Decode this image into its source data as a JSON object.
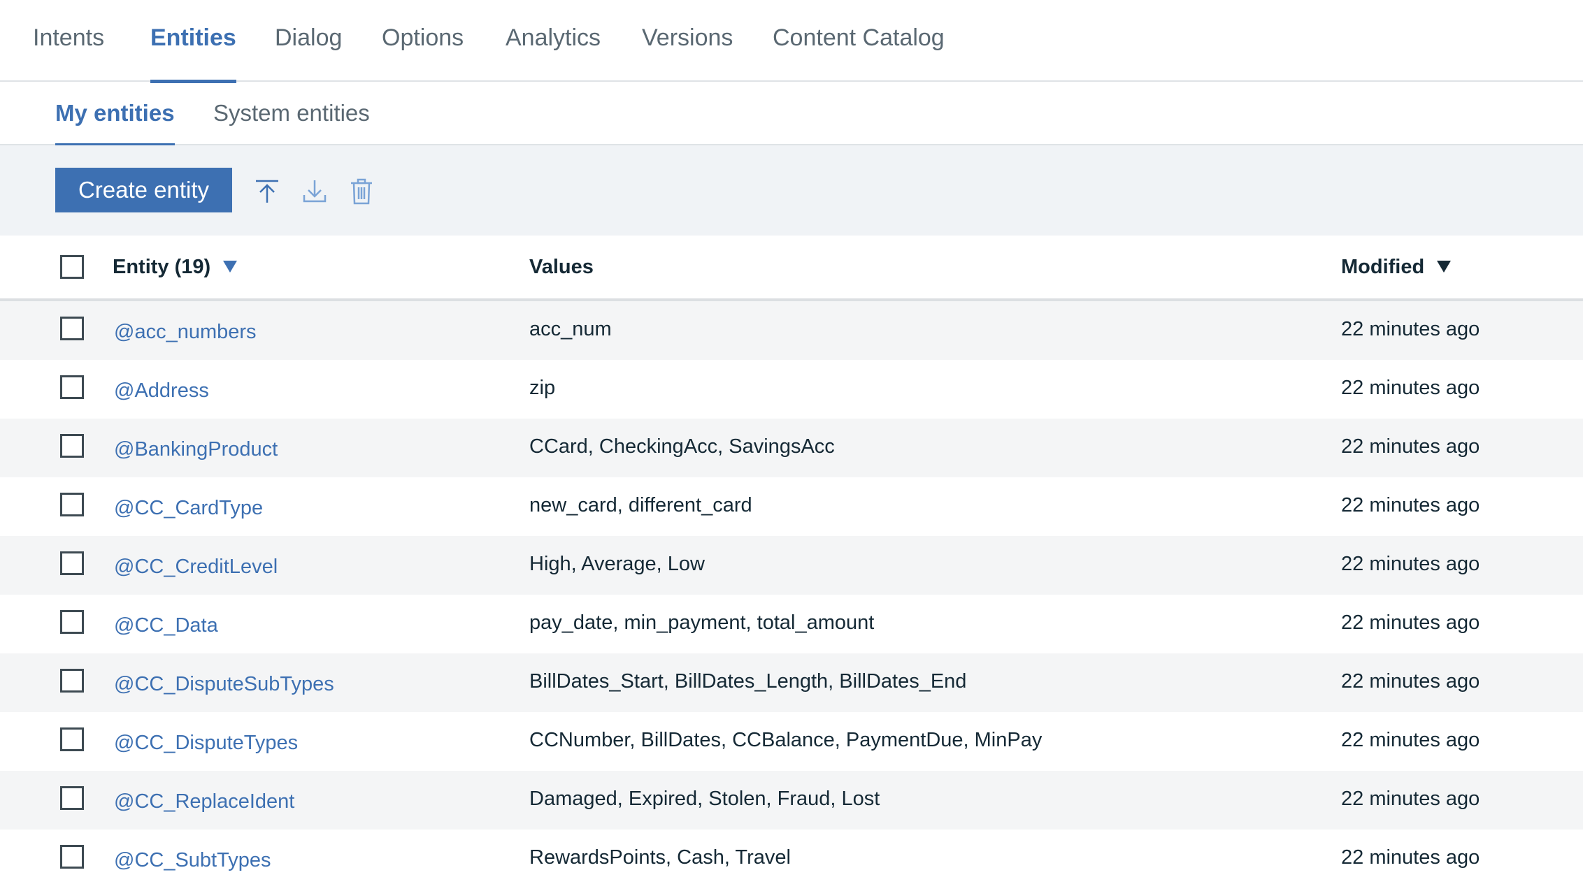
{
  "top_tabs": [
    "Intents",
    "Entities",
    "Dialog",
    "Options",
    "Analytics",
    "Versions",
    "Content Catalog"
  ],
  "active_top_tab": "Entities",
  "sub_tabs": [
    "My entities",
    "System entities"
  ],
  "active_sub_tab": "My entities",
  "toolbar": {
    "create_label": "Create entity",
    "icons": [
      "upload-icon",
      "download-icon",
      "trash-icon"
    ]
  },
  "table": {
    "headers": {
      "entity": "Entity (19)",
      "values": "Values",
      "modified": "Modified"
    },
    "rows": [
      {
        "name": "@acc_numbers",
        "values": "acc_num",
        "modified": "22 minutes ago"
      },
      {
        "name": "@Address",
        "values": "zip",
        "modified": "22 minutes ago"
      },
      {
        "name": "@BankingProduct",
        "values": "CCard, CheckingAcc, SavingsAcc",
        "modified": "22 minutes ago"
      },
      {
        "name": "@CC_CardType",
        "values": "new_card, different_card",
        "modified": "22 minutes ago"
      },
      {
        "name": "@CC_CreditLevel",
        "values": "High, Average, Low",
        "modified": "22 minutes ago"
      },
      {
        "name": "@CC_Data",
        "values": "pay_date, min_payment, total_amount",
        "modified": "22 minutes ago"
      },
      {
        "name": "@CC_DisputeSubTypes",
        "values": "BillDates_Start, BillDates_Length, BillDates_End",
        "modified": "22 minutes ago"
      },
      {
        "name": "@CC_DisputeTypes",
        "values": "CCNumber, BillDates, CCBalance, PaymentDue, MinPay",
        "modified": "22 minutes ago"
      },
      {
        "name": "@CC_ReplaceIdent",
        "values": "Damaged, Expired, Stolen, Fraud, Lost",
        "modified": "22 minutes ago"
      },
      {
        "name": "@CC_SubtTypes",
        "values": "RewardsPoints, Cash, Travel",
        "modified": "22 minutes ago"
      }
    ]
  },
  "colors": {
    "accent": "#3d70b2",
    "text": "#152935",
    "muted": "#5a6872",
    "toolbar_bg": "#f0f3f6",
    "row_alt": "#f4f5f6"
  }
}
